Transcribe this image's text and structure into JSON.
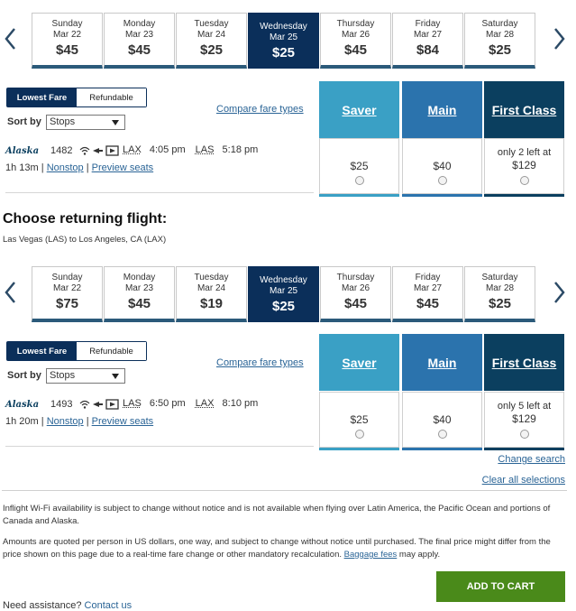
{
  "outbound": {
    "days": [
      {
        "name": "Sunday",
        "date": "Mar 22",
        "price": "$45"
      },
      {
        "name": "Monday",
        "date": "Mar 23",
        "price": "$45"
      },
      {
        "name": "Tuesday",
        "date": "Mar 24",
        "price": "$25"
      },
      {
        "name": "Wednesday",
        "date": "Mar 25",
        "price": "$25",
        "selected": true
      },
      {
        "name": "Thursday",
        "date": "Mar 26",
        "price": "$45"
      },
      {
        "name": "Friday",
        "date": "Mar 27",
        "price": "$84"
      },
      {
        "name": "Saturday",
        "date": "Mar 28",
        "price": "$25"
      }
    ],
    "toggle": {
      "on": "Lowest Fare",
      "off": "Refundable"
    },
    "sort_label": "Sort by",
    "sort_value": "Stops",
    "compare": "Compare fare types",
    "fare_headers": {
      "saver": "Saver",
      "main": "Main",
      "first": "First Class"
    },
    "flight": {
      "airline": "Alaska",
      "number": "1482",
      "from": "LAX",
      "depart": "4:05 pm",
      "to": "LAS",
      "arrive": "5:18 pm",
      "duration": "1h 13m",
      "stops": "Nonstop",
      "preview": "Preview seats",
      "saver_price": "$25",
      "main_price": "$40",
      "first_note": "only 2 left at",
      "first_price": "$129"
    }
  },
  "return": {
    "heading": "Choose returning flight:",
    "route": "Las Vegas (LAS) to Los Angeles, CA (LAX)",
    "days": [
      {
        "name": "Sunday",
        "date": "Mar 22",
        "price": "$75"
      },
      {
        "name": "Monday",
        "date": "Mar 23",
        "price": "$45"
      },
      {
        "name": "Tuesday",
        "date": "Mar 24",
        "price": "$19"
      },
      {
        "name": "Wednesday",
        "date": "Mar 25",
        "price": "$25",
        "selected": true
      },
      {
        "name": "Thursday",
        "date": "Mar 26",
        "price": "$45"
      },
      {
        "name": "Friday",
        "date": "Mar 27",
        "price": "$45"
      },
      {
        "name": "Saturday",
        "date": "Mar 28",
        "price": "$25"
      }
    ],
    "toggle": {
      "on": "Lowest Fare",
      "off": "Refundable"
    },
    "sort_label": "Sort by",
    "sort_value": "Stops",
    "compare": "Compare fare types",
    "fare_headers": {
      "saver": "Saver",
      "main": "Main",
      "first": "First Class"
    },
    "flight": {
      "airline": "Alaska",
      "number": "1493",
      "from": "LAS",
      "depart": "6:50 pm",
      "to": "LAX",
      "arrive": "8:10 pm",
      "duration": "1h 20m",
      "stops": "Nonstop",
      "preview": "Preview seats",
      "saver_price": "$25",
      "main_price": "$40",
      "first_note": "only 5 left at",
      "first_price": "$129"
    }
  },
  "links": {
    "change_search": "Change search",
    "clear_all": "Clear all selections"
  },
  "fine_print": {
    "wifi": "Inflight Wi-Fi availability is subject to change without notice and is not available when flying over Latin America, the Pacific Ocean and portions of Canada and Alaska.",
    "amounts": "Amounts are quoted per person in US dollars, one way, and subject to change without notice until purchased. The final price might differ from the price shown on this page due to a real-time fare change or other mandatory recalculation.",
    "baggage_link": "Baggage fees",
    "baggage_tail": "may apply."
  },
  "cart_button": "ADD TO CART",
  "assist": {
    "text": "Need assistance?",
    "link": "Contact us"
  },
  "colors": {
    "navy": "#0b2f5a",
    "saver": "#3aa0c5",
    "main": "#2b73ad",
    "first": "#0b3f5f",
    "cart": "#4a8a1a"
  }
}
